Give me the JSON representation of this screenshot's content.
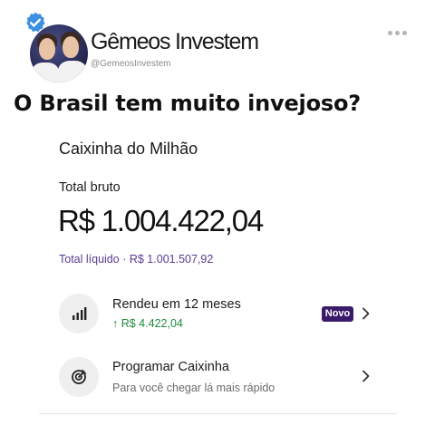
{
  "post": {
    "author_name": "Gêmeos Investem",
    "author_handle": "@GemeosInvestem",
    "text": "O Brasil tem muito invejoso?",
    "icons": [
      "verified-badge-icon",
      "more-options-icon"
    ]
  },
  "app_screen": {
    "box_title": "Caixinha do Milhão",
    "gross_label": "Total bruto",
    "gross_value": "R$ 1.004.422,04",
    "net_label": "Total líquido",
    "net_separator": "·",
    "net_value": "R$ 1.001.507,92",
    "rows": [
      {
        "icon": "bar-chart-icon",
        "title": "Rendeu em 12 meses",
        "subtitle_arrow": "↑",
        "subtitle": "R$ 4.422,04",
        "badge": "Novo"
      },
      {
        "icon": "target-icon",
        "title": "Programar Caixinha",
        "subtitle": "Para você chegar lá mais rápido"
      }
    ]
  },
  "colors": {
    "accent_purple": "#5a3a96",
    "badge_bg": "#3c1a6b",
    "positive_green": "#1e8a3c",
    "verified_blue": "#3d8fe0"
  }
}
